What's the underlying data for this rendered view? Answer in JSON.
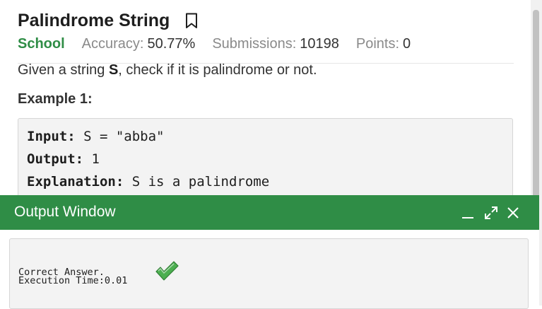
{
  "problem": {
    "title": "Palindrome String",
    "difficulty": "School",
    "accuracy_label": "Accuracy:",
    "accuracy_value": "50.77%",
    "submissions_label": "Submissions:",
    "submissions_value": "10198",
    "points_label": "Points:",
    "points_value": "0",
    "statement_before": "Given a string ",
    "statement_var": "S",
    "statement_after": ", check if it is palindrome or not.",
    "example_heading": "Example 1:",
    "example": {
      "input_label": "Input:",
      "input_value": " S = \"abba\"",
      "output_label": "Output:",
      "output_value": " 1",
      "explanation_label": "Explanation:",
      "explanation_value": " S is a palindrome"
    }
  },
  "output_window": {
    "title": "Output Window",
    "result_text": "Correct Answer.",
    "execution_time": "Execution Time:0.01"
  },
  "colors": {
    "brand_green": "#2f8d46",
    "check_green": "#4caf50"
  },
  "icons": {
    "bookmark": "bookmark-icon",
    "minimize": "minimize-icon",
    "maximize": "maximize-icon",
    "close": "close-icon",
    "check": "checkmark-icon"
  }
}
